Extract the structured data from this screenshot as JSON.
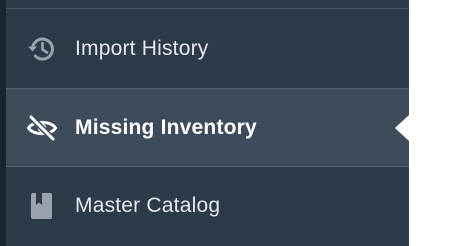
{
  "sidebar": {
    "items": [
      {
        "label": "Import History",
        "icon": "history-icon",
        "active": false
      },
      {
        "label": "Missing Inventory",
        "icon": "eye-off-icon",
        "active": true
      },
      {
        "label": "Master Catalog",
        "icon": "book-icon",
        "active": false
      }
    ]
  },
  "colors": {
    "sidebar_bg": "#2d3a4a",
    "active_bg": "#3e4b5b",
    "icon": "#9aa3ad",
    "active_icon": "#ffffff",
    "text": "#e4e8ec"
  }
}
